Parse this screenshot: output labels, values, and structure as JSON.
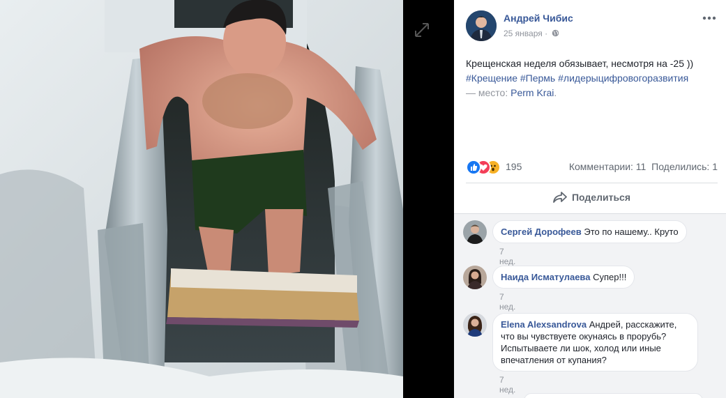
{
  "post": {
    "author": "Андрей Чибис",
    "date": "25 января",
    "separator": "·",
    "text_main": "Крещенская неделя обязывает, несмотря на -25 ))",
    "hashtags": "#Крещение #Пермь #лидерыцифровогоразвития",
    "location_prefix": "— место:",
    "location": "Perm Krai",
    "location_suffix": "."
  },
  "stats": {
    "reactions_count": "195",
    "comments_label": "Комментарии: 11",
    "shares_label": "Поделились: 1",
    "reaction_types": [
      "like-icon",
      "love-icon",
      "wow-icon"
    ]
  },
  "actions": {
    "share_label": "Поделиться"
  },
  "comments": [
    {
      "name": "Сергей Дорофеев",
      "text": "Это по нашему.. Круто",
      "time": "7 нед."
    },
    {
      "name": "Наида Исматулаева",
      "text": "Супер!!!",
      "time": "7 нед."
    },
    {
      "name": "Elena Alexsandrova",
      "text": "Андрей, расскажите, что вы чувствуете окунаясь в прорубь? Испытываете ли шок, холод или иные впечатления от купания?",
      "time": "7 нед."
    }
  ],
  "colors": {
    "link": "#385898",
    "like": "#1877f2",
    "love": "#f33e58",
    "wow": "#f7b125"
  }
}
